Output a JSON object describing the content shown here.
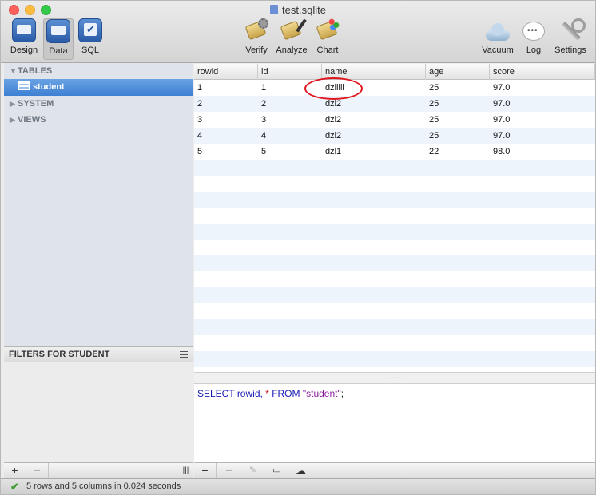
{
  "window": {
    "title": "test.sqlite"
  },
  "toolbar": {
    "left": [
      {
        "label": "Design",
        "icon": "design-icon"
      },
      {
        "label": "Data",
        "icon": "data-icon"
      },
      {
        "label": "SQL",
        "icon": "sql-icon"
      }
    ],
    "center": [
      {
        "label": "Verify",
        "icon": "verify-icon"
      },
      {
        "label": "Analyze",
        "icon": "analyze-icon"
      },
      {
        "label": "Chart",
        "icon": "chart-icon"
      }
    ],
    "right": [
      {
        "label": "Vacuum",
        "icon": "cloud-icon"
      },
      {
        "label": "Log",
        "icon": "speech-bubble-icon"
      },
      {
        "label": "Settings",
        "icon": "wrench-icon"
      }
    ]
  },
  "sidebar": {
    "tables_label": "TABLES",
    "selected_table": "student",
    "system_label": "SYSTEM",
    "views_label": "VIEWS"
  },
  "filters": {
    "title": "FILTERS FOR STUDENT"
  },
  "grid": {
    "columns": [
      "rowid",
      "id",
      "name",
      "age",
      "score"
    ],
    "rows": [
      [
        "1",
        "1",
        "dzlllll",
        "25",
        "97.0"
      ],
      [
        "2",
        "2",
        "dzl2",
        "25",
        "97.0"
      ],
      [
        "3",
        "3",
        "dzl2",
        "25",
        "97.0"
      ],
      [
        "4",
        "4",
        "dzl2",
        "25",
        "97.0"
      ],
      [
        "5",
        "5",
        "dzl1",
        "22",
        "98.0"
      ]
    ]
  },
  "splitter": {
    "grip": "....."
  },
  "editor": {
    "select": "SELECT",
    "rowid": "rowid,",
    "star": "*",
    "from": "FROM",
    "table": "\"student\"",
    "semi": ";"
  },
  "bottom_left": {
    "add": "+",
    "remove": "−",
    "resize": "|||"
  },
  "bottom_right": {
    "add": "+",
    "remove": "−",
    "edit": "✎",
    "comment": "▭",
    "upload": "☁"
  },
  "status": {
    "text": "5 rows and 5 columns in 0.024 seconds"
  },
  "colors": {
    "selection": "#3d7fd2",
    "annotation": "#e0161e",
    "keyword": "#1a1ab5"
  }
}
